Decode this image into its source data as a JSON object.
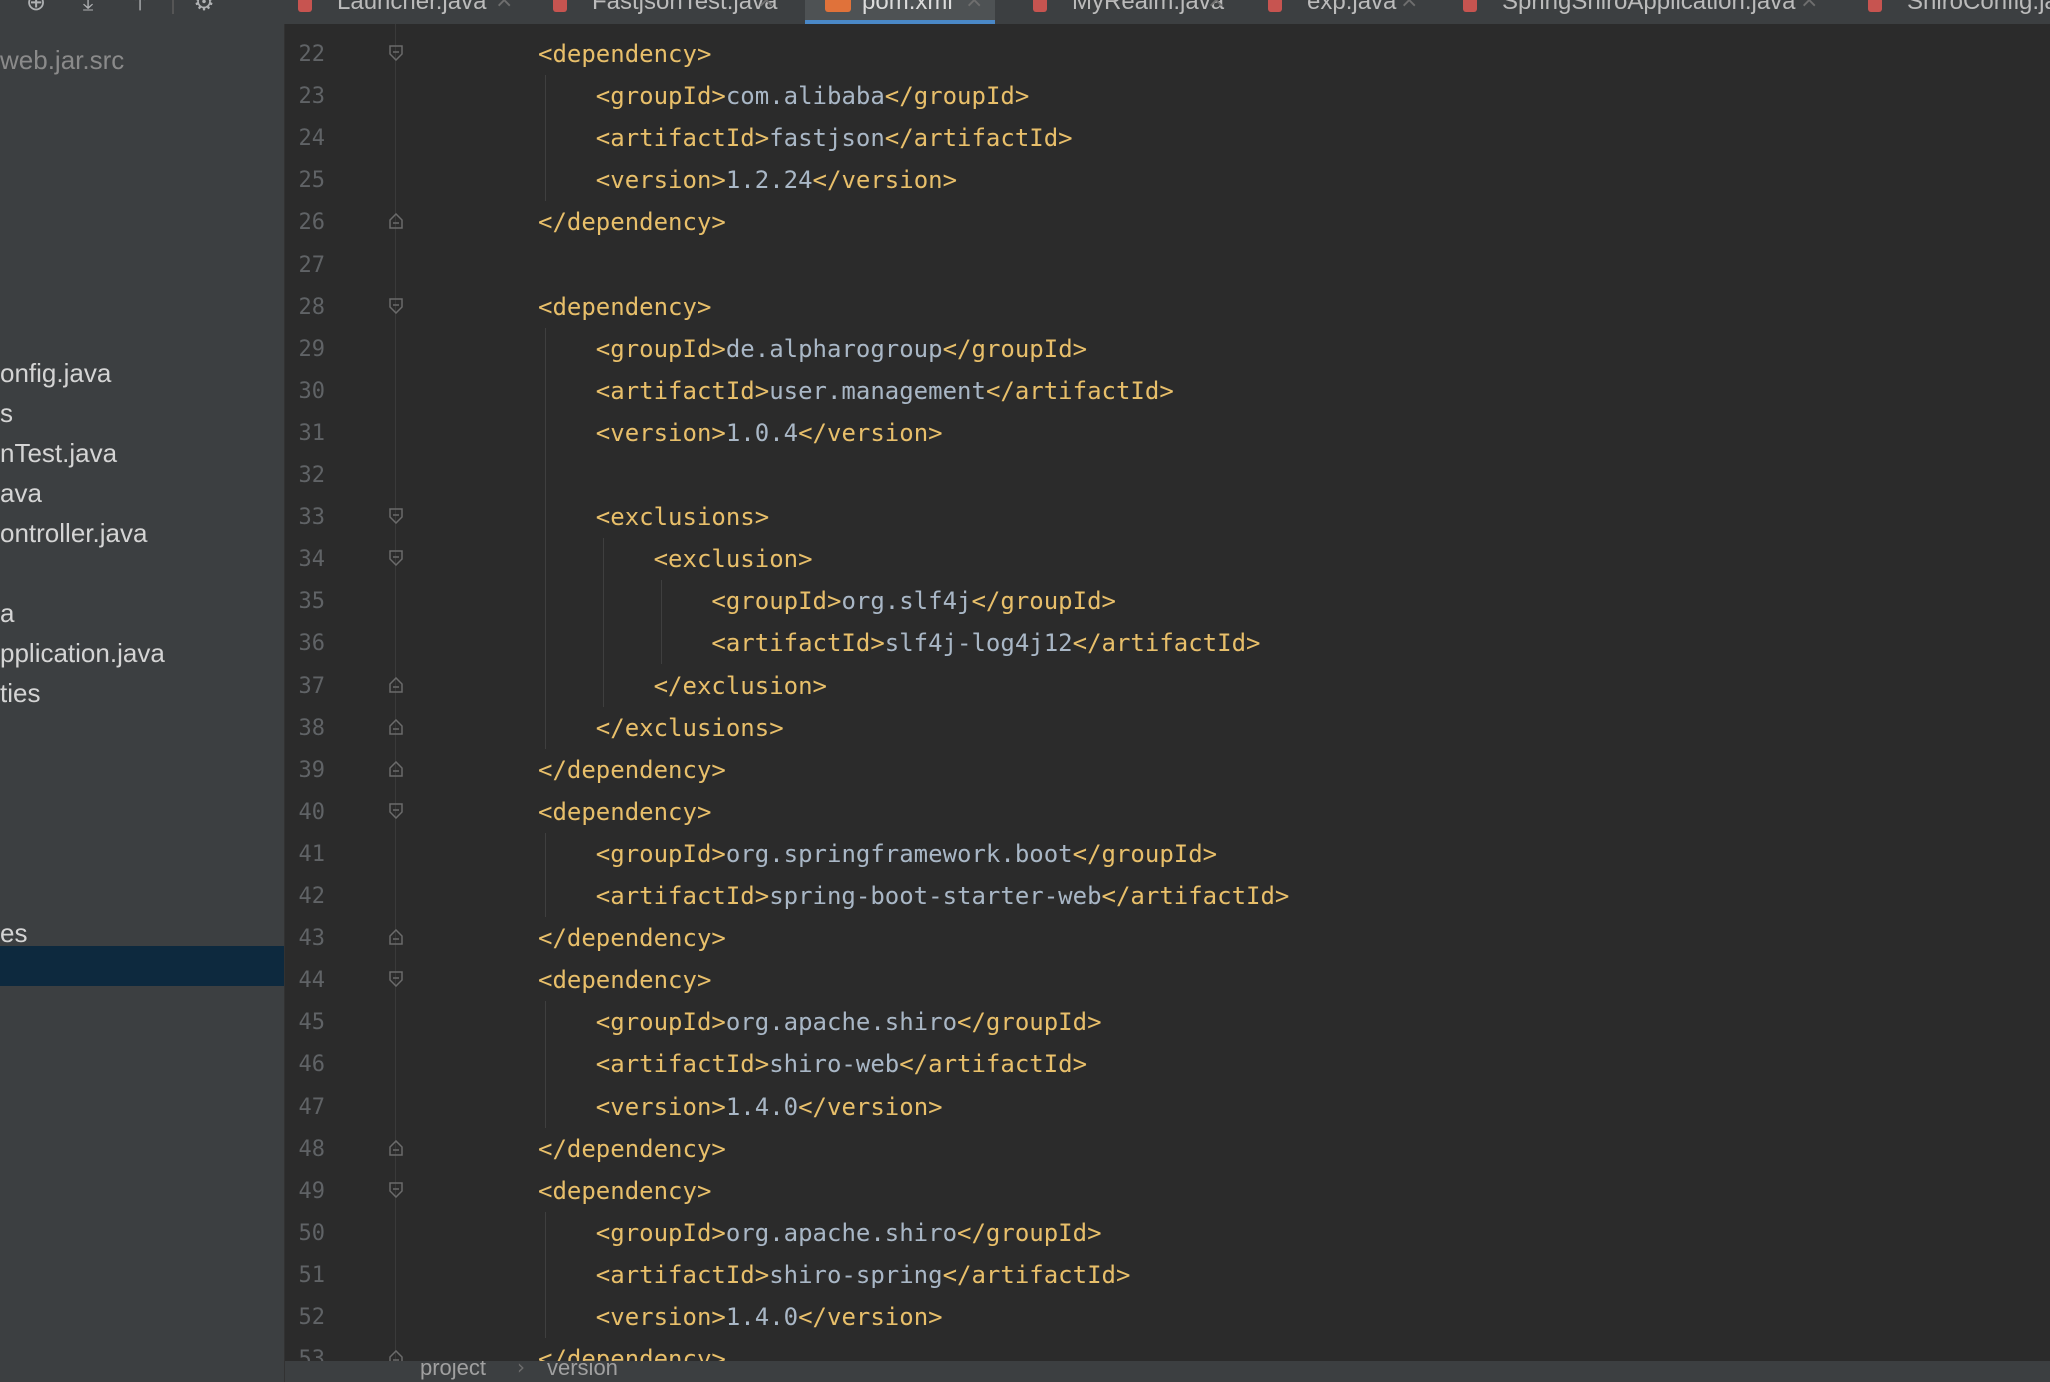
{
  "toolbar": {
    "icons": [
      "locate-icon",
      "expand-all-icon",
      "collapse-all-icon",
      "settings-gear-icon"
    ]
  },
  "tabs": [
    {
      "label": "Launcher.java",
      "type": "java"
    },
    {
      "label": "FastjsonTest.java",
      "type": "java"
    },
    {
      "label": "pom.xml",
      "type": "xml",
      "active": true
    },
    {
      "label": "MyRealm.java",
      "type": "java"
    },
    {
      "label": "exp.java",
      "type": "java"
    },
    {
      "label": "SpringShiroApplication.java",
      "type": "java"
    },
    {
      "label": "ShiroConfig.java",
      "type": "java"
    }
  ],
  "sidebar": {
    "items": [
      {
        "label": "web.jar.src"
      },
      {
        "label": "onfig.java"
      },
      {
        "label": "s"
      },
      {
        "label": "nTest.java"
      },
      {
        "label": "ava"
      },
      {
        "label": "ontroller.java"
      },
      {
        "label": "a"
      },
      {
        "label": "pplication.java"
      },
      {
        "label": "ties"
      },
      {
        "label": "es"
      }
    ]
  },
  "editor": {
    "lines": [
      {
        "n": "22",
        "text": "<dependency>"
      },
      {
        "n": "23",
        "text": "<groupId>com.alibaba</groupId>"
      },
      {
        "n": "24",
        "text": "<artifactId>fastjson</artifactId>"
      },
      {
        "n": "25",
        "text": "<version>1.2.24</version>"
      },
      {
        "n": "26",
        "text": "</dependency>"
      },
      {
        "n": "27",
        "text": ""
      },
      {
        "n": "28",
        "text": "<dependency>"
      },
      {
        "n": "29",
        "text": "<groupId>de.alpharogroup</groupId>"
      },
      {
        "n": "30",
        "text": "<artifactId>user.management</artifactId>"
      },
      {
        "n": "31",
        "text": "<version>1.0.4</version>"
      },
      {
        "n": "32",
        "text": ""
      },
      {
        "n": "33",
        "text": "<exclusions>"
      },
      {
        "n": "34",
        "text": "<exclusion>"
      },
      {
        "n": "35",
        "text": "<groupId>org.slf4j</groupId>"
      },
      {
        "n": "36",
        "text": "<artifactId>slf4j-log4j12</artifactId>"
      },
      {
        "n": "37",
        "text": "</exclusion>"
      },
      {
        "n": "38",
        "text": "</exclusions>"
      },
      {
        "n": "39",
        "text": "</dependency>"
      },
      {
        "n": "40",
        "text": "<dependency>"
      },
      {
        "n": "41",
        "text": "<groupId>org.springframework.boot</groupId>"
      },
      {
        "n": "42",
        "text": "<artifactId>spring-boot-starter-web</artifactId>"
      },
      {
        "n": "43",
        "text": "</dependency>"
      },
      {
        "n": "44",
        "text": "<dependency>"
      },
      {
        "n": "45",
        "text": "<groupId>org.apache.shiro</groupId>"
      },
      {
        "n": "46",
        "text": "<artifactId>shiro-web</artifactId>"
      },
      {
        "n": "47",
        "text": "<version>1.4.0</version>"
      },
      {
        "n": "48",
        "text": "</dependency>"
      },
      {
        "n": "49",
        "text": "<dependency>"
      },
      {
        "n": "50",
        "text": "<groupId>org.apache.shiro</groupId>"
      },
      {
        "n": "51",
        "text": "<artifactId>shiro-spring</artifactId>"
      },
      {
        "n": "52",
        "text": "<version>1.4.0</version>"
      },
      {
        "n": "53",
        "text": "</dependency>"
      }
    ]
  },
  "breadcrumb": {
    "items": [
      "project",
      "version"
    ]
  },
  "colors": {
    "tag": "#e8bf6a",
    "text": "#a9b7c6",
    "line_number": "#606366",
    "editor_bg": "#2b2b2b",
    "sidebar_bg": "#3c3f41",
    "selection": "#0d293e",
    "active_tab_underline": "#4a88c7"
  }
}
